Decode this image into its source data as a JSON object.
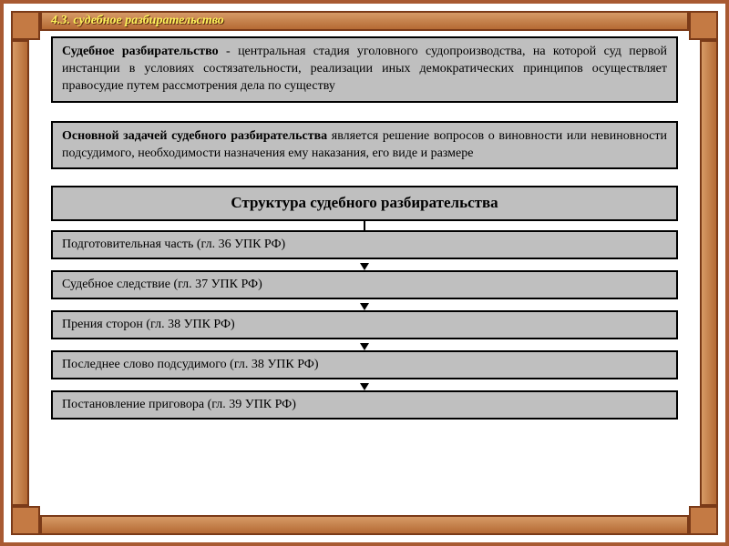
{
  "header": {
    "title": "4.3. судебное разбирательство"
  },
  "definition": {
    "term": "Судебное разбирательство",
    "dash": " - ",
    "text": "центральная стадия уголовного судопроизводства, на которой суд первой инстанции в условиях состязательности, реализации иных демократических принципов осуществляет правосудие путем рассмотрения дела по существу"
  },
  "task": {
    "lead": "Основной задачей судебного разбирательства",
    "text": " является решение вопросов о виновности или невиновности подсудимого, необходимости назначения ему наказания, его виде и размере"
  },
  "structure_title": "Структура судебного разбирательства",
  "stages": [
    "Подготовительная часть (гл. 36 УПК РФ)",
    "Судебное следствие (гл. 37 УПК РФ)",
    "Прения сторон (гл. 38 УПК РФ)",
    "Последнее слово подсудимого (гл. 38 УПК РФ)",
    "Постановление приговора (гл. 39 УПК РФ)"
  ]
}
